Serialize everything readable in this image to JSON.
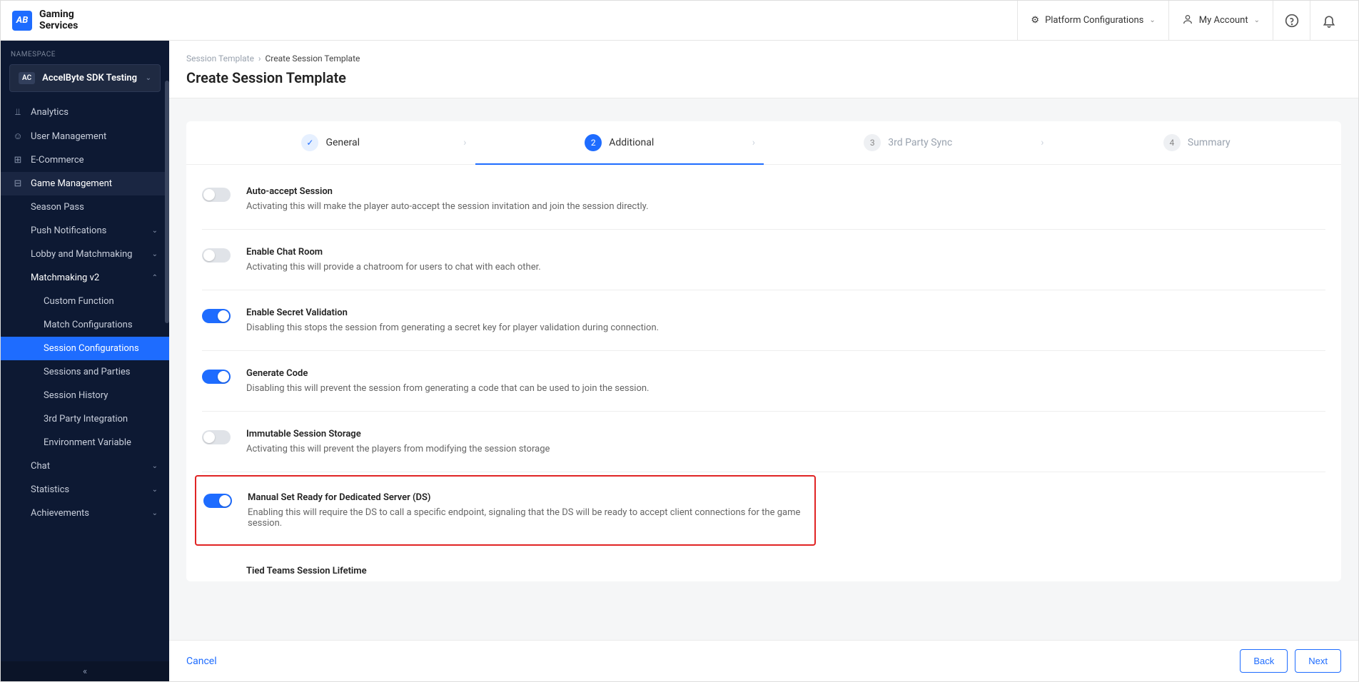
{
  "brand": {
    "badge": "AB",
    "line1": "Gaming",
    "line2": "Services"
  },
  "topbar": {
    "platform": "Platform Configurations",
    "account": "My Account"
  },
  "sidebar": {
    "nsLabel": "NAMESPACE",
    "nsBadge": "AC",
    "nsName": "AccelByte SDK Testing",
    "items": [
      {
        "label": "Analytics"
      },
      {
        "label": "User Management"
      },
      {
        "label": "E-Commerce"
      },
      {
        "label": "Game Management"
      }
    ],
    "sub": [
      {
        "label": "Season Pass"
      },
      {
        "label": "Push Notifications",
        "expandable": true
      },
      {
        "label": "Lobby and Matchmaking",
        "expandable": true
      },
      {
        "label": "Matchmaking v2",
        "expandable": true,
        "expanded": true
      }
    ],
    "sub2": [
      {
        "label": "Custom Function"
      },
      {
        "label": "Match Configurations"
      },
      {
        "label": "Session Configurations",
        "selected": true
      },
      {
        "label": "Sessions and Parties"
      },
      {
        "label": "Session History"
      },
      {
        "label": "3rd Party Integration"
      },
      {
        "label": "Environment Variable"
      }
    ],
    "subAfter": [
      {
        "label": "Chat",
        "expandable": true
      },
      {
        "label": "Statistics",
        "expandable": true
      },
      {
        "label": "Achievements",
        "expandable": true
      }
    ]
  },
  "breadcrumb": {
    "parent": "Session Template",
    "current": "Create Session Template"
  },
  "pageTitle": "Create Session Template",
  "steps": [
    {
      "num": "✓",
      "label": "General",
      "state": "done"
    },
    {
      "num": "2",
      "label": "Additional",
      "state": "active"
    },
    {
      "num": "3",
      "label": "3rd Party Sync",
      "state": ""
    },
    {
      "num": "4",
      "label": "Summary",
      "state": ""
    }
  ],
  "settings": [
    {
      "title": "Auto-accept Session",
      "desc": "Activating this will make the player auto-accept the session invitation and join the session directly.",
      "on": false
    },
    {
      "title": "Enable Chat Room",
      "desc": "Activating this will provide a chatroom for users to chat with each other.",
      "on": false
    },
    {
      "title": "Enable Secret Validation",
      "desc": "Disabling this stops the session from generating a secret key for player validation during connection.",
      "on": true
    },
    {
      "title": "Generate Code",
      "desc": "Disabling this will prevent the session from generating a code that can be used to join the session.",
      "on": true
    },
    {
      "title": "Immutable Session Storage",
      "desc": "Activating this will prevent the players from modifying the session storage",
      "on": false
    },
    {
      "title": "Manual Set Ready for Dedicated Server (DS)",
      "desc": "Enabling this will require the DS to call a specific endpoint, signaling that the DS will be ready to accept client connections for the game session.",
      "on": true,
      "highlight": true
    },
    {
      "title": "Tied Teams Session Lifetime",
      "desc": "",
      "on": false,
      "partial": true
    }
  ],
  "footer": {
    "cancel": "Cancel",
    "back": "Back",
    "next": "Next"
  }
}
